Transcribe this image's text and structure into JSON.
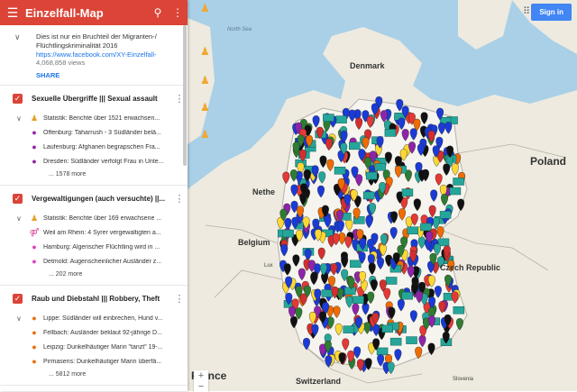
{
  "app_title": "Einzelfall-Map",
  "description": {
    "text": "Dies ist nur ein Bruchteil der Migranten-/ Flüchtlingskriminalität 2016",
    "link": "https://www.facebook.com/XY-Einzelfall-",
    "views": "4,068,858 views",
    "share": "SHARE"
  },
  "layers": [
    {
      "name": "Sexuelle Übergriffe ||| Sexual assault",
      "items": [
        {
          "icon": "person-icon",
          "color": "#e6a020",
          "text": "Statistik: Berichte über 1521 erwachsen..."
        },
        {
          "icon": "pin-icon",
          "color": "#8e24aa",
          "text": "Offenburg: Taharrush - 3 Südländer belä..."
        },
        {
          "icon": "pin-icon",
          "color": "#8e24aa",
          "text": "Laufenburg: Afghanen begrapschen Fra..."
        },
        {
          "icon": "pin-icon",
          "color": "#8e24aa",
          "text": "Dresden: Südländer verfolgt Frau in Unte..."
        }
      ],
      "more": "... 1578 more"
    },
    {
      "name": "Vergewaltigungen (auch versuchte) ||...",
      "items": [
        {
          "icon": "person-icon",
          "color": "#e6a020",
          "text": "Statistik: Berichte über 169 erwachsene ..."
        },
        {
          "icon": "couple-icon",
          "color": "#e040a0",
          "text": "Weil am Rhein: 4 Syrer vergewaltigten a..."
        },
        {
          "icon": "pin-icon",
          "color": "#e040c0",
          "text": "Hamburg: Algerischer Flüchtling wird in ..."
        },
        {
          "icon": "pin-icon",
          "color": "#e040c0",
          "text": "Detmold: Augenscheinlicher Ausländer z..."
        }
      ],
      "more": "... 202 more"
    },
    {
      "name": "Raub und Diebstahl ||| Robbery, Theft",
      "items": [
        {
          "icon": "pin-icon",
          "color": "#ef6c00",
          "text": "Lippe: Südländer will einbrechen, Hund v..."
        },
        {
          "icon": "pin-icon",
          "color": "#ef6c00",
          "text": "Fellbach: Ausländer beklaut 92-jährige D..."
        },
        {
          "icon": "pin-icon",
          "color": "#ef6c00",
          "text": "Leipzig: Dunkelhäutiger Mann \"tanzt\" 19-..."
        },
        {
          "icon": "pin-icon",
          "color": "#ef6c00",
          "text": "Pirmasens: Dunkelhäutiger Mann überfä..."
        }
      ],
      "more": "... 5812 more"
    }
  ],
  "map": {
    "signin": "Sign in",
    "labels": {
      "denmark": "Denmark",
      "poland": "Poland",
      "czech": "Czech Republic",
      "belgium": "Belgium",
      "france": "France",
      "netherlands": "Nethe",
      "switzerland": "Switzerland",
      "north_sea": "North Sea",
      "luxembourg": "Lux",
      "slovenia": "Slovenia"
    },
    "colors": {
      "water": "#a9d0e6",
      "land": "#eeeae0",
      "germany": "#f6f4ee",
      "border": "#b5b0a8"
    }
  }
}
